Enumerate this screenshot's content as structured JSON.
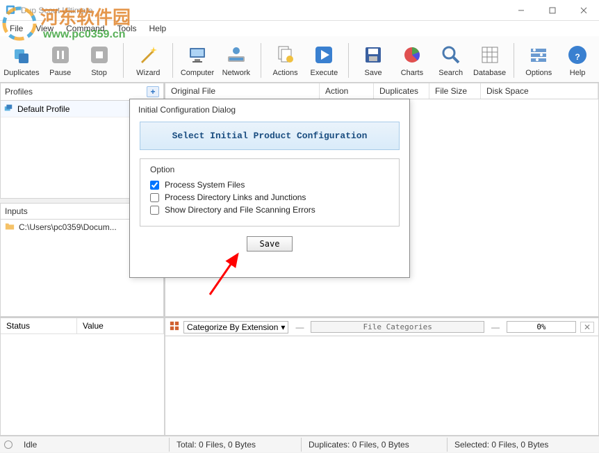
{
  "window": {
    "title": "Dup Scout Ultimate"
  },
  "menubar": {
    "items": [
      "File",
      "View",
      "Command",
      "Tools",
      "Help"
    ]
  },
  "toolbar": {
    "items": [
      {
        "id": "duplicates",
        "label": "Duplicates"
      },
      {
        "id": "pause",
        "label": "Pause"
      },
      {
        "id": "stop",
        "label": "Stop"
      },
      {
        "id": "wizard",
        "label": "Wizard"
      },
      {
        "id": "computer",
        "label": "Computer"
      },
      {
        "id": "network",
        "label": "Network"
      },
      {
        "id": "actions",
        "label": "Actions"
      },
      {
        "id": "execute",
        "label": "Execute"
      },
      {
        "id": "save",
        "label": "Save"
      },
      {
        "id": "charts",
        "label": "Charts"
      },
      {
        "id": "search",
        "label": "Search"
      },
      {
        "id": "database",
        "label": "Database"
      },
      {
        "id": "options",
        "label": "Options"
      },
      {
        "id": "help",
        "label": "Help"
      }
    ]
  },
  "profiles": {
    "title": "Profiles",
    "items": [
      "Default Profile"
    ]
  },
  "inputs": {
    "title": "Inputs",
    "items": [
      "C:\\Users\\pc0359\\Docum..."
    ]
  },
  "grid": {
    "columns": [
      "Original File",
      "Action",
      "Duplicates",
      "File Size",
      "Disk Space"
    ]
  },
  "bottomLeft": {
    "columns": [
      "Status",
      "Value"
    ]
  },
  "categoryBar": {
    "combo_label": "Categorize By Extension",
    "button_label": "File Categories",
    "progress_text": "0%"
  },
  "statusbar": {
    "idle": "Idle",
    "total": "Total: 0 Files, 0 Bytes",
    "duplicates": "Duplicates: 0 Files, 0 Bytes",
    "selected": "Selected: 0 Files, 0 Bytes"
  },
  "dialog": {
    "title": "Initial Configuration Dialog",
    "header": "Select Initial Product Configuration",
    "option_header": "Option",
    "options": [
      {
        "label": "Process System Files",
        "checked": true
      },
      {
        "label": "Process Directory Links and Junctions",
        "checked": false
      },
      {
        "label": "Show Directory and File Scanning Errors",
        "checked": false
      }
    ],
    "save_label": "Save"
  },
  "watermark": {
    "text_cn": "河东软件园",
    "url": "www.pc0359.cn"
  }
}
